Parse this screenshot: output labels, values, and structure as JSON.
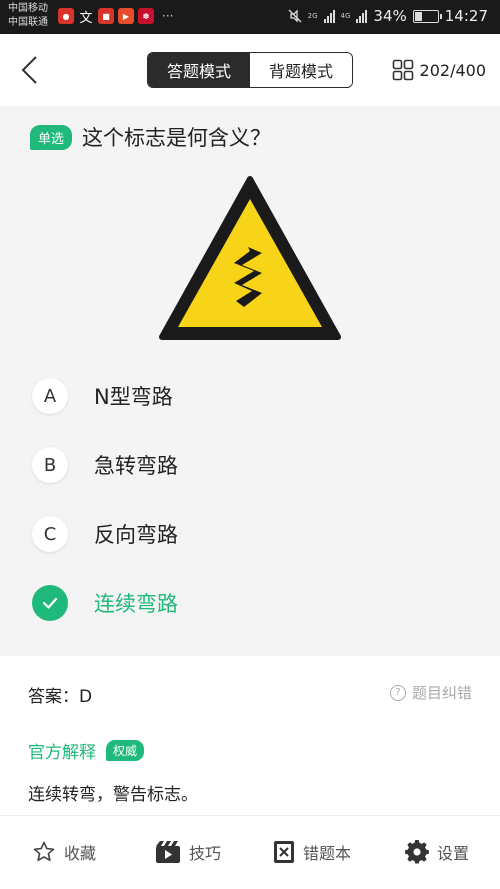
{
  "status_bar": {
    "carrier_1": "中国移动",
    "carrier_2": "中国联通",
    "net_1": "2G",
    "net_2": "4G",
    "battery_text": "34%",
    "battery_level": 0.34,
    "time": "14:27",
    "more": "···"
  },
  "header": {
    "mode_answer": "答题模式",
    "mode_recite": "背题模式",
    "progress": "202/400"
  },
  "question": {
    "type_tag": "单选",
    "text": "这个标志是何含义？",
    "options": [
      {
        "letter": "A",
        "label": "N型弯路"
      },
      {
        "letter": "B",
        "label": "急转弯路"
      },
      {
        "letter": "C",
        "label": "反向弯路"
      },
      {
        "letter": "D",
        "label": "连续弯路",
        "selected": true
      }
    ]
  },
  "answer": {
    "label": "答案：D",
    "report": "题目纠错",
    "explain_title": "官方解释",
    "explain_badge": "权威",
    "explain_text": "连续转弯，警告标志。"
  },
  "bottom_nav": [
    {
      "icon": "star-icon",
      "label": "收藏"
    },
    {
      "icon": "video-icon",
      "label": "技巧"
    },
    {
      "icon": "wrong-book-icon",
      "label": "错题本"
    },
    {
      "icon": "gear-icon",
      "label": "设置"
    }
  ],
  "colors": {
    "accent": "#1fb97c",
    "dark": "#2b2b2b",
    "sign_yellow": "#f7d417"
  }
}
